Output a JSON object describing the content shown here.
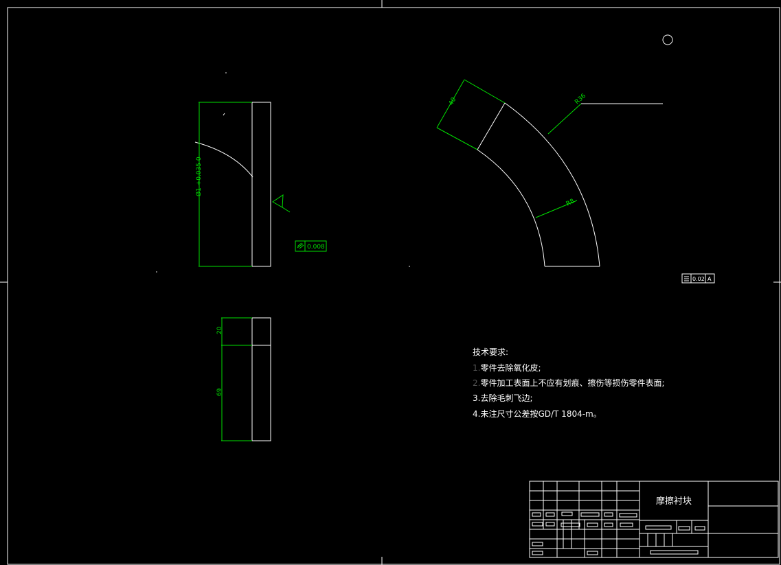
{
  "drawing": {
    "front_view": {
      "diameter_dim": "Ø1 +0.035 0",
      "flatness_tol": "0.008"
    },
    "side_view": {
      "dim_top": "20",
      "dim_bottom": "69"
    },
    "arc_view": {
      "width_dim": "40",
      "outer_radius_dim": "R36",
      "inner_radius_dim": "R8",
      "tolerance_value": "0.02",
      "tolerance_datum": "A"
    },
    "requirements": {
      "title": "技术要求:",
      "items": [
        {
          "num": "1.",
          "text": "零件去除氧化皮;"
        },
        {
          "num": "2.",
          "text": "零件加工表面上不应有划痕、擦伤等损伤零件表面;"
        },
        {
          "num": "3.",
          "text": "去除毛刺飞边;"
        },
        {
          "num": "4.",
          "text": "未注尺寸公差按GD/T 1804-m。"
        }
      ]
    },
    "title_block": {
      "part_name": "摩擦衬块"
    }
  }
}
